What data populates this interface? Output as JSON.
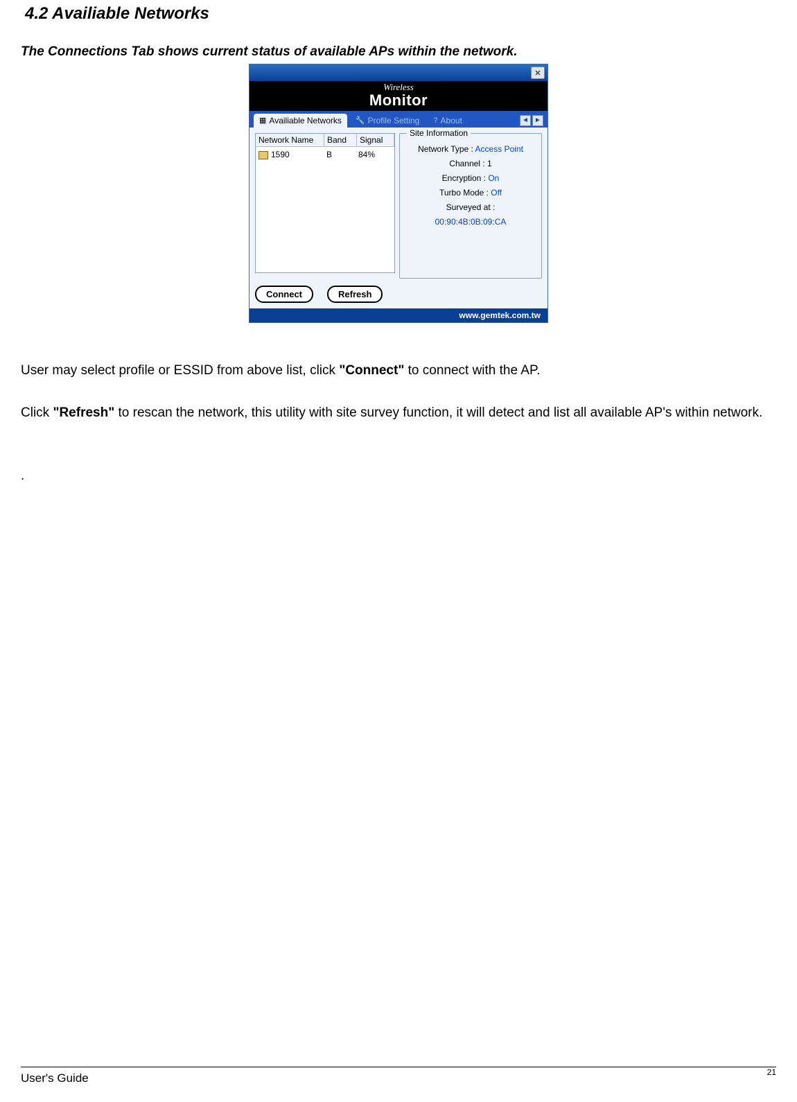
{
  "section_title": "4.2 Availiable Networks",
  "intro": "The Connections Tab shows  current status of available APs within the network.",
  "dialog": {
    "close_glyph": "✕",
    "banner_top": "Wireless",
    "banner_bottom": "Monitor",
    "tabs": {
      "active": "Availiable Networks",
      "profile": "Profile Setting",
      "about": "About",
      "nav_left": "◄",
      "nav_right": "►"
    },
    "list": {
      "headers": {
        "name": "Network Name",
        "band": "Band",
        "signal": "Signal"
      },
      "rows": [
        {
          "name": "1590",
          "band": "B",
          "signal": "84%"
        }
      ]
    },
    "siteinfo": {
      "legend": "Site Information",
      "type_label": "Network Type :",
      "type_value": " Access Point",
      "channel": "Channel : 1",
      "enc_label": "Encryption : ",
      "enc_value": "On",
      "turbo_label": "Turbo Mode : ",
      "turbo_value": "Off",
      "surveyed": "Surveyed at :",
      "mac": "00:90:4B:0B:09:CA"
    },
    "buttons": {
      "connect": "Connect",
      "refresh": "Refresh"
    },
    "footer": "www.gemtek.com.tw"
  },
  "para1_pre": "User may select profile or ESSID from above list, click ",
  "para1_bold": "\"Connect\"",
  "para1_post": " to connect with the AP.",
  "para2_pre": "Click ",
  "para2_bold": "\"Refresh\"",
  "para2_post": " to rescan the network, this utility with site survey function, it will detect and list all available AP's within network.",
  "dot": ".",
  "footer_left": "User's Guide",
  "footer_right": "21"
}
